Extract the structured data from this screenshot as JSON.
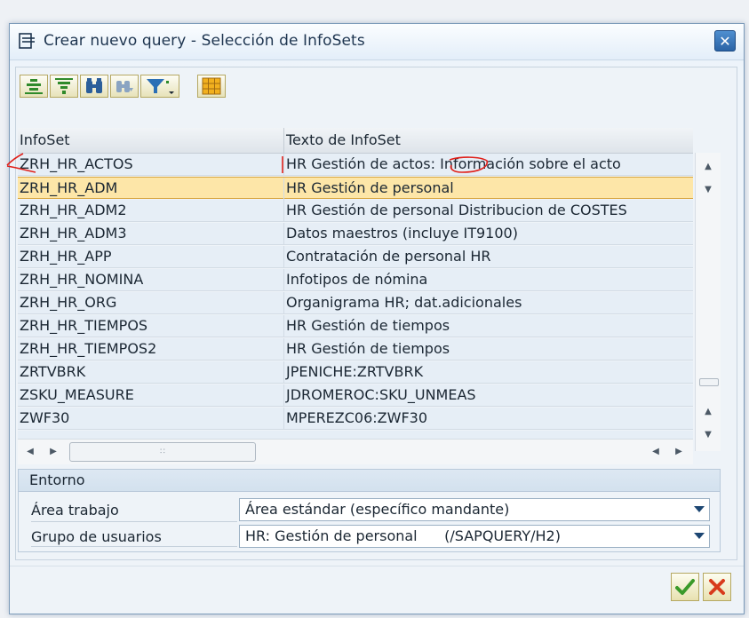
{
  "dialog": {
    "title": "Crear nuevo query - Selección de InfoSets"
  },
  "toolbar": {
    "buttons": [
      "align-center-icon",
      "align-bottom-icon",
      "find-icon",
      "find-next-icon",
      "filter-icon",
      "layout-grid-icon"
    ]
  },
  "table": {
    "columns": [
      "InfoSet",
      "Texto de InfoSet"
    ],
    "selected_index": 1,
    "rows": [
      {
        "infoset": "ZRH_HR_ACTOS",
        "texto": "HR Gestión de actos: Información sobre el acto"
      },
      {
        "infoset": "ZRH_HR_ADM",
        "texto": "HR Gestión de personal"
      },
      {
        "infoset": "ZRH_HR_ADM2",
        "texto": "HR Gestión de personal Distribucion de COSTES"
      },
      {
        "infoset": "ZRH_HR_ADM3",
        "texto": "Datos maestros (incluye IT9100)"
      },
      {
        "infoset": "ZRH_HR_APP",
        "texto": "Contratación de personal HR"
      },
      {
        "infoset": "ZRH_HR_NOMINA",
        "texto": "Infotipos de nómina"
      },
      {
        "infoset": "ZRH_HR_ORG",
        "texto": "Organigrama HR; dat.adicionales"
      },
      {
        "infoset": "ZRH_HR_TIEMPOS",
        "texto": "HR Gestión de tiempos"
      },
      {
        "infoset": "ZRH_HR_TIEMPOS2",
        "texto": "HR Gestión de tiempos"
      },
      {
        "infoset": "ZRTVBRK",
        "texto": "JPENICHE:ZRTVBRK"
      },
      {
        "infoset": "ZSKU_MEASURE",
        "texto": "JDROMEROC:SKU_UNMEAS"
      },
      {
        "infoset": "ZWF30",
        "texto": "MPEREZC06:ZWF30"
      }
    ]
  },
  "entorno": {
    "title": "Entorno",
    "area_label": "Área trabajo",
    "area_value": "Área estándar (específico mandante)",
    "grupo_label": "Grupo de usuarios",
    "grupo_value": "HR: Gestión de personal      (/SAPQUERY/H2)"
  },
  "footer": {
    "buttons": [
      "checkmark-icon",
      "cancel-icon"
    ]
  },
  "colors": {
    "selected_row": "#fde6a8",
    "annotation": "#e0201a",
    "confirm": "#3a9a2a",
    "cancel": "#d83a1c"
  }
}
